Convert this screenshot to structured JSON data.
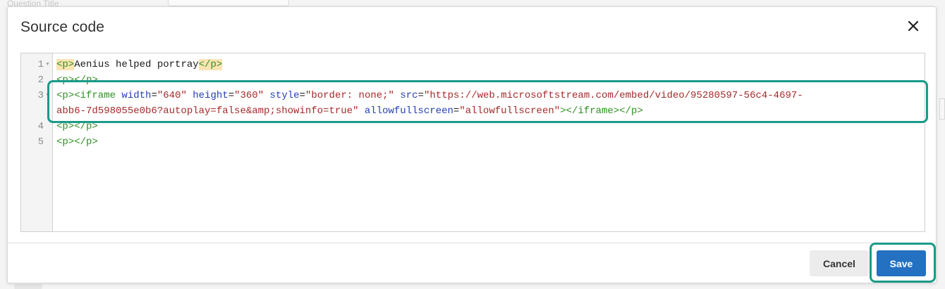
{
  "background": {
    "field_label": "Question Title"
  },
  "dialog": {
    "title": "Source code",
    "close_icon": "close-icon"
  },
  "editor": {
    "line_numbers": [
      "1",
      "2",
      "3",
      "4",
      "5"
    ],
    "lines": {
      "l1_open": "<p>",
      "l1_text": "Aenius helped portray",
      "l1_close": "</p>",
      "l2": "<p></p>",
      "l3_open": "<p><iframe",
      "l3_attr_width": "width",
      "l3_val_width": "\"640\"",
      "l3_attr_height": "height",
      "l3_val_height": "\"360\"",
      "l3_attr_style": "style",
      "l3_val_style": "\"border: none;\"",
      "l3_attr_src": "src",
      "l3_val_src_a": "\"https://web.microsoftstream.com/embed/video/95280597-56c4-4697-",
      "l3_val_src_b": "abb6-7d598055e0b6?autoplay=false&amp;showinfo=true\"",
      "l3_attr_allow": "allowfullscreen",
      "l3_val_allow": "\"allowfullscreen\"",
      "l3_close": "></iframe></p>",
      "l4": "<p></p>",
      "l5": "<p></p>"
    }
  },
  "footer": {
    "cancel_label": "Cancel",
    "save_label": "Save"
  },
  "colors": {
    "highlight": "#1a9a8a",
    "save_button": "#2470c1",
    "tag": "#2f8f23",
    "attribute": "#243fb5",
    "string": "#a52a2a"
  }
}
